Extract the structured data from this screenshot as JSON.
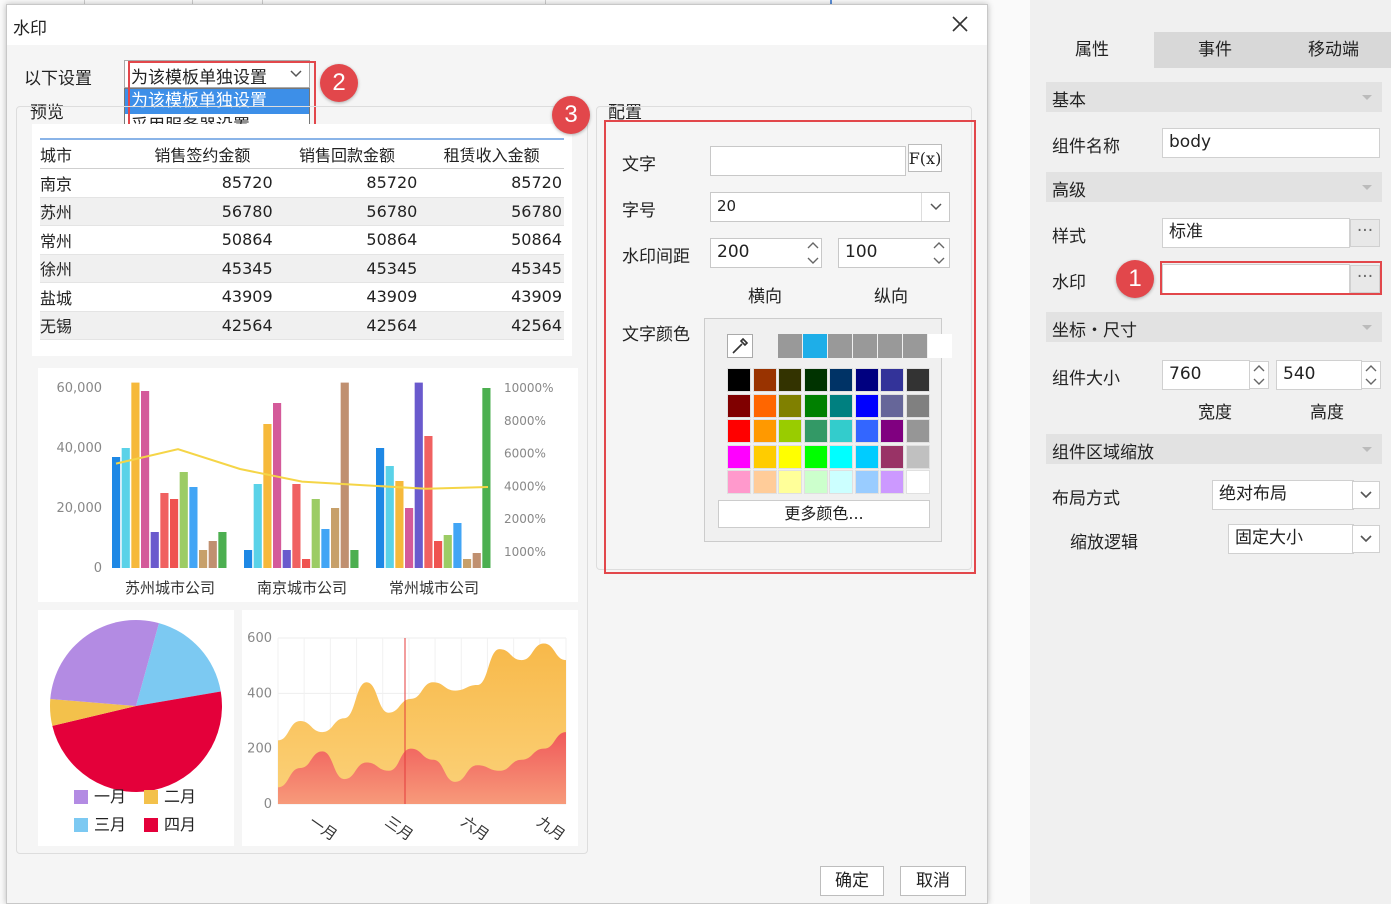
{
  "dialog": {
    "title": "水印",
    "settings_label": "以下设置",
    "scope_select": {
      "value": "为该模板单独设置",
      "options": [
        "为该模板单独设置",
        "采用服务器设置"
      ]
    },
    "preview_label": "预览",
    "config_label": "配置",
    "ok_label": "确定",
    "cancel_label": "取消"
  },
  "badges": [
    "1",
    "2",
    "3"
  ],
  "preview_table": {
    "headers": [
      "城市",
      "销售签约金额",
      "销售回款金额",
      "租赁收入金额"
    ],
    "rows": [
      [
        "南京",
        "85720",
        "85720",
        "85720"
      ],
      [
        "苏州",
        "56780",
        "56780",
        "56780"
      ],
      [
        "常州",
        "50864",
        "50864",
        "50864"
      ],
      [
        "徐州",
        "45345",
        "45345",
        "45345"
      ],
      [
        "盐城",
        "43909",
        "43909",
        "43909"
      ],
      [
        "无锡",
        "42564",
        "42564",
        "42564"
      ]
    ]
  },
  "chart_data": [
    {
      "type": "bar",
      "categories": [
        "苏州城市公司",
        "南京城市公司",
        "常州城市公司"
      ],
      "y_ticks": [
        "60,000",
        "40,000",
        "20,000",
        "0"
      ],
      "y2_ticks": [
        "10000%",
        "8000%",
        "6000%",
        "4000%",
        "2000%",
        "1000%"
      ],
      "ylim": [
        0,
        60000
      ],
      "series": [
        {
          "values": [
            37000,
            6000,
            40000
          ],
          "color": "#1e88e5"
        },
        {
          "values": [
            40000,
            28000,
            34000
          ],
          "color": "#5ad2e8"
        },
        {
          "values": [
            62000,
            48000,
            29000
          ],
          "color": "#f6b93b"
        },
        {
          "values": [
            59000,
            55000,
            20000
          ],
          "color": "#d45a9a"
        },
        {
          "values": [
            12000,
            6000,
            62000
          ],
          "color": "#6a5acd"
        },
        {
          "values": [
            25000,
            28000,
            44000
          ],
          "color": "#f06161"
        },
        {
          "values": [
            23000,
            3000,
            9000
          ],
          "color": "#ef5350"
        },
        {
          "values": [
            32000,
            23000,
            11000
          ],
          "color": "#9ccc65"
        },
        {
          "values": [
            27000,
            13000,
            15000
          ],
          "color": "#42a5f5"
        },
        {
          "values": [
            6000,
            20000,
            3000
          ],
          "color": "#c7a06a"
        },
        {
          "values": [
            9000,
            70000,
            5000
          ],
          "color": "#c09070"
        },
        {
          "values": [
            12000,
            6000,
            60000
          ],
          "color": "#4caf50"
        }
      ],
      "line": {
        "values": [
          58,
          66,
          55,
          48,
          46,
          44,
          45
        ],
        "color": "#f5d547"
      }
    },
    {
      "type": "pie",
      "series": [
        {
          "name": "一月",
          "value": 28,
          "color": "#b38be3"
        },
        {
          "name": "二月",
          "value": 5,
          "color": "#f3c14b"
        },
        {
          "name": "三月",
          "value": 18,
          "color": "#7cc9f2"
        },
        {
          "name": "四月",
          "value": 49,
          "color": "#e4003a"
        }
      ]
    },
    {
      "type": "area",
      "categories": [
        "一月",
        "三月",
        "六月",
        "九月"
      ],
      "y_ticks": [
        "600",
        "400",
        "200",
        "0"
      ],
      "ylim": [
        0,
        600
      ],
      "series": [
        {
          "values": [
            230,
            300,
            260,
            310,
            440,
            330,
            380,
            440,
            410,
            430,
            560,
            520,
            580,
            520
          ],
          "color": "#f8b94a"
        },
        {
          "values": [
            60,
            130,
            190,
            90,
            150,
            120,
            200,
            160,
            80,
            140,
            120,
            160,
            200,
            260
          ],
          "color": "#f05a5a"
        }
      ]
    }
  ],
  "config": {
    "text_label": "文字",
    "text_value": "",
    "fx_label": "F(x)",
    "size_label": "字号",
    "size_value": "20",
    "spacing_label": "水印间距",
    "spacing_h": "200",
    "spacing_v": "100",
    "h_label": "横向",
    "v_label": "纵向",
    "color_label": "文字颜色",
    "more_colors": "更多颜色...",
    "recent_colors": [
      "#999999",
      "#1eaee8",
      "#999999",
      "#999999",
      "#999999",
      "#999999",
      "#ffffff"
    ],
    "palette": [
      [
        "#000000",
        "#993300",
        "#333300",
        "#003300",
        "#003366",
        "#000080",
        "#333399",
        "#333333"
      ],
      [
        "#800000",
        "#ff6600",
        "#808000",
        "#008000",
        "#008080",
        "#0000ff",
        "#666699",
        "#808080"
      ],
      [
        "#ff0000",
        "#ff9900",
        "#99cc00",
        "#339966",
        "#33cccc",
        "#3366ff",
        "#800080",
        "#969696"
      ],
      [
        "#ff00ff",
        "#ffcc00",
        "#ffff00",
        "#00ff00",
        "#00ffff",
        "#00ccff",
        "#993366",
        "#c0c0c0"
      ],
      [
        "#ff99cc",
        "#ffcc99",
        "#ffff99",
        "#ccffcc",
        "#ccffff",
        "#99ccff",
        "#cc99ff",
        "#ffffff"
      ]
    ]
  },
  "right_panel": {
    "tabs": [
      "属性",
      "事件",
      "移动端"
    ],
    "sec_basic": "基本",
    "name_label": "组件名称",
    "name_value": "body",
    "sec_advanced": "高级",
    "style_label": "样式",
    "style_value": "标准",
    "watermark_label": "水印",
    "watermark_value": "",
    "more_btn": "···",
    "sec_position": "坐标・尺寸",
    "size_label": "组件大小",
    "width_value": "760",
    "height_value": "540",
    "width_label": "宽度",
    "height_label": "高度",
    "sec_scale": "组件区域缩放",
    "layout_label": "布局方式",
    "layout_value": "绝对布局",
    "scale_label": "缩放逻辑",
    "scale_value": "固定大小"
  }
}
